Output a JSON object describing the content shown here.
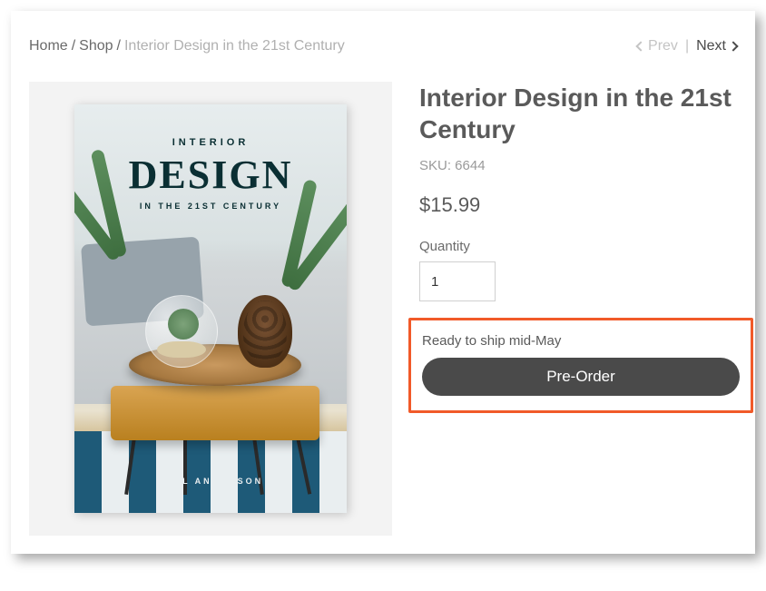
{
  "breadcrumb": {
    "home": "Home",
    "shop": "Shop",
    "current": "Interior Design in the 21st Century"
  },
  "pager": {
    "prev": "Prev",
    "next": "Next"
  },
  "product": {
    "title": "Interior Design in the 21st Century",
    "sku_label": "SKU: 6644",
    "price": "$15.99",
    "quantity_label": "Quantity",
    "quantity_value": "1",
    "ship_message": "Ready to ship mid-May",
    "preorder_label": "Pre-Order"
  },
  "cover": {
    "sup": "INTERIOR",
    "title": "DESIGN",
    "sub": "IN THE 21ST CENTURY",
    "author": "PAUL ANDERSON"
  }
}
